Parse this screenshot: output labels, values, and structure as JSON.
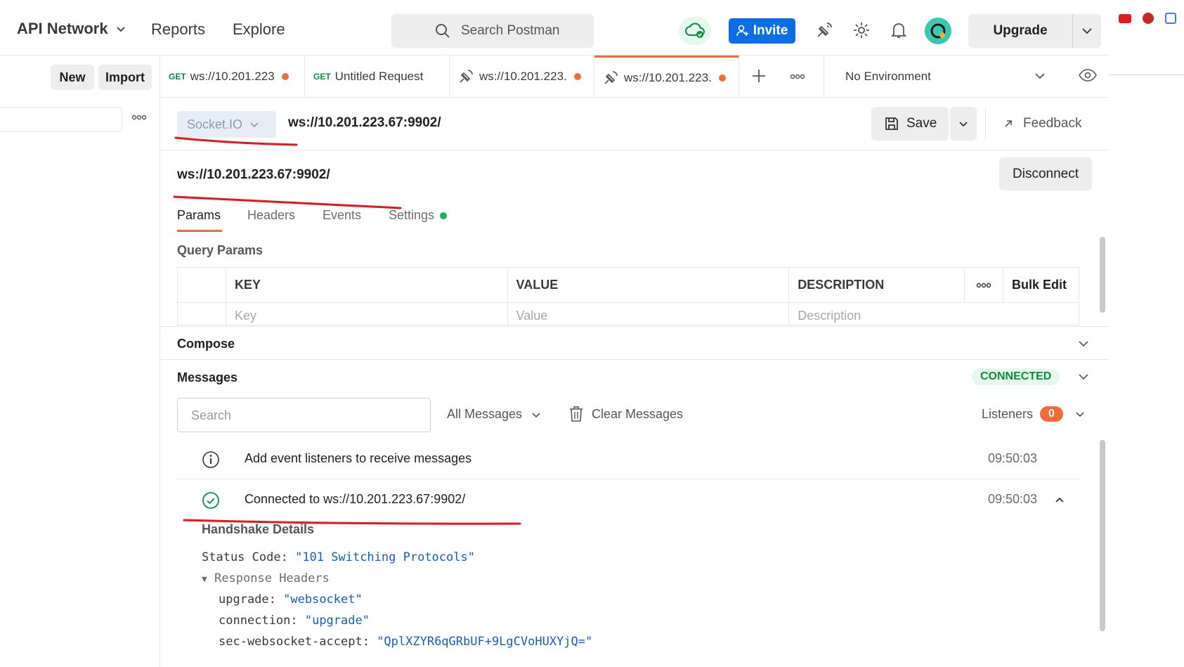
{
  "header": {
    "workspace": "API Network",
    "nav": [
      "Reports",
      "Explore"
    ],
    "search_placeholder": "Search Postman",
    "invite_label": "Invite",
    "upgrade_label": "Upgrade"
  },
  "sidebar": {
    "new_label": "New",
    "import_label": "Import"
  },
  "tabs": [
    {
      "method": "GET",
      "label": "ws://10.201.223"
    },
    {
      "method": "GET",
      "label": "Untitled Request"
    },
    {
      "method": "",
      "label": "ws://10.201.223."
    },
    {
      "method": "",
      "label": "ws://10.201.223."
    }
  ],
  "environment": "No Environment",
  "request": {
    "protocol": "Socket.IO",
    "url": "ws://10.201.223.67:9902/",
    "title": "ws://10.201.223.67:9902/",
    "save_label": "Save",
    "feedback_label": "Feedback",
    "disconnect_label": "Disconnect",
    "subtabs": [
      "Params",
      "Headers",
      "Events",
      "Settings"
    ],
    "query_params_title": "Query Params",
    "columns": [
      "KEY",
      "VALUE",
      "DESCRIPTION"
    ],
    "bulk_edit_label": "Bulk Edit",
    "placeholders": {
      "key": "Key",
      "value": "Value",
      "description": "Description"
    }
  },
  "compose_title": "Compose",
  "messages": {
    "title": "Messages",
    "status": "CONNECTED",
    "search_placeholder": "Search",
    "filter": "All Messages",
    "clear_label": "Clear Messages",
    "listeners_label": "Listeners",
    "listeners_count": "0",
    "items": [
      {
        "text": "Add event listeners to receive messages",
        "time": "09:50:03"
      },
      {
        "text": "Connected to ws://10.201.223.67:9902/",
        "time": "09:50:03"
      }
    ],
    "handshake": {
      "title": "Handshake Details",
      "status_key": "Status Code:",
      "status_val": "\"101 Switching Protocols\"",
      "resp_headers": "Response Headers",
      "headers": [
        {
          "k": "upgrade:",
          "v": "\"websocket\""
        },
        {
          "k": "connection:",
          "v": "\"upgrade\""
        },
        {
          "k": "sec-websocket-accept:",
          "v": "\"QplXZYR6qGRbUF+9LgCVoHUXYjQ=\""
        }
      ]
    }
  },
  "colors": {
    "accent": "#f26b3a",
    "invite": "#0c6de5",
    "connected": "#0b8c3e",
    "annotation": "#e8141c"
  }
}
